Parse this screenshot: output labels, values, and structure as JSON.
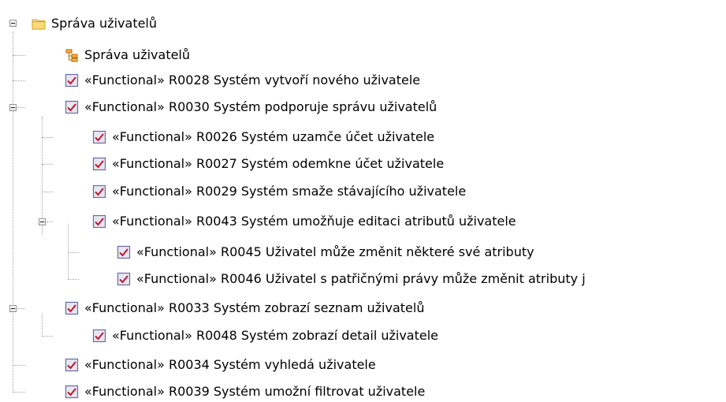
{
  "tree": {
    "root": {
      "label": "Správa uživatelů",
      "icon": "package-folder-icon"
    },
    "items": [
      {
        "label": "Správa uživatelů",
        "icon": "diagram-icon",
        "level": 1
      },
      {
        "label": "«Functional» R0028 Systém vytvoří nového uživatele",
        "icon": "requirement-icon",
        "level": 1
      },
      {
        "label": "«Functional» R0030 Systém podporuje správu uživatelů",
        "icon": "requirement-icon",
        "level": 1,
        "expanded": true
      },
      {
        "label": "«Functional» R0026 Systém uzamče účet uživatele",
        "icon": "requirement-icon",
        "level": 2
      },
      {
        "label": "«Functional» R0027 Systém odemkne účet uživatele",
        "icon": "requirement-icon",
        "level": 2
      },
      {
        "label": "«Functional» R0029 Systém smaže stávajícího uživatele",
        "icon": "requirement-icon",
        "level": 2
      },
      {
        "label": "«Functional» R0043 Systém umožňuje editaci atributů uživatele",
        "icon": "requirement-icon",
        "level": 2,
        "expanded": true
      },
      {
        "label": "«Functional» R0045 Uživatel může změnit některé své atributy",
        "icon": "requirement-icon",
        "level": 3
      },
      {
        "label": "«Functional» R0046 Uživatel s patřičnými právy může změnit atributy j",
        "icon": "requirement-icon",
        "level": 3
      },
      {
        "label": "«Functional» R0033 Systém zobrazí seznam uživatelů",
        "icon": "requirement-icon",
        "level": 1,
        "expanded": true
      },
      {
        "label": "«Functional» R0048 Systém zobrazí detail uživatele",
        "icon": "requirement-icon",
        "level": 2
      },
      {
        "label": "«Functional» R0034 Systém vyhledá uživatele",
        "icon": "requirement-icon",
        "level": 1
      },
      {
        "label": "«Functional» R0039 Systém umožní filtrovat uživatele",
        "icon": "requirement-icon",
        "level": 1
      }
    ]
  }
}
